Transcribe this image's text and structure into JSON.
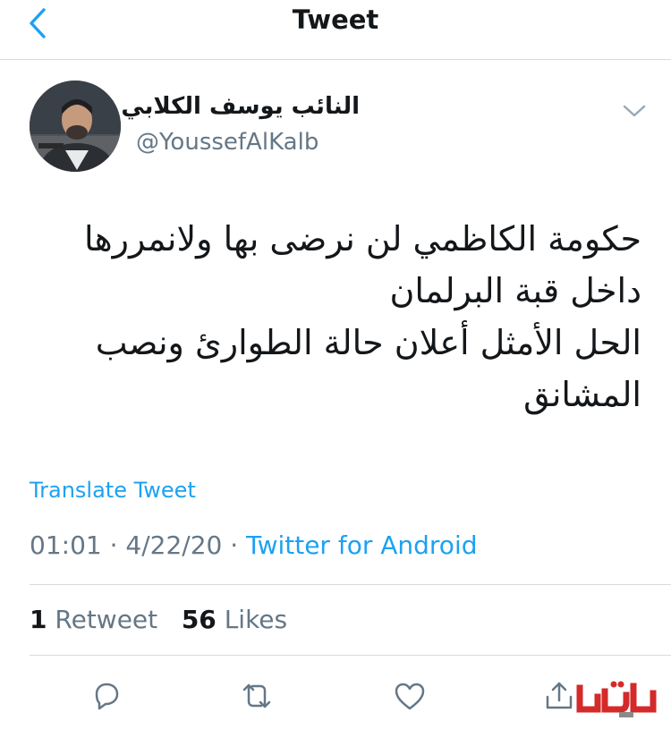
{
  "header": {
    "title": "Tweet",
    "back_icon": "chevron-left-icon"
  },
  "author": {
    "display_name": "النائب يوسف الكلابي",
    "handle": "@YoussefAlKalb"
  },
  "tweet": {
    "lines": [
      "حكومة الكاظمي لن نرضى بها ولانمررها",
      "داخل قبة البرلمان",
      "الحل الأمثل أعلان حالة الطوارئ ونصب",
      "المشانق"
    ],
    "translate_label": "Translate Tweet",
    "time": "01:01",
    "separator": "·",
    "date": "4/22/20",
    "source": "Twitter for Android"
  },
  "stats": {
    "retweets_count": "1",
    "retweets_label": "Retweet",
    "likes_count": "56",
    "likes_label": "Likes"
  },
  "actions": [
    "reply-icon",
    "retweet-icon",
    "like-icon",
    "share-icon"
  ],
  "colors": {
    "accent": "#1da1f2",
    "text": "#14171a",
    "secondary": "#657786",
    "border": "#d6dbe0",
    "watermark_red": "#d42a2a"
  }
}
